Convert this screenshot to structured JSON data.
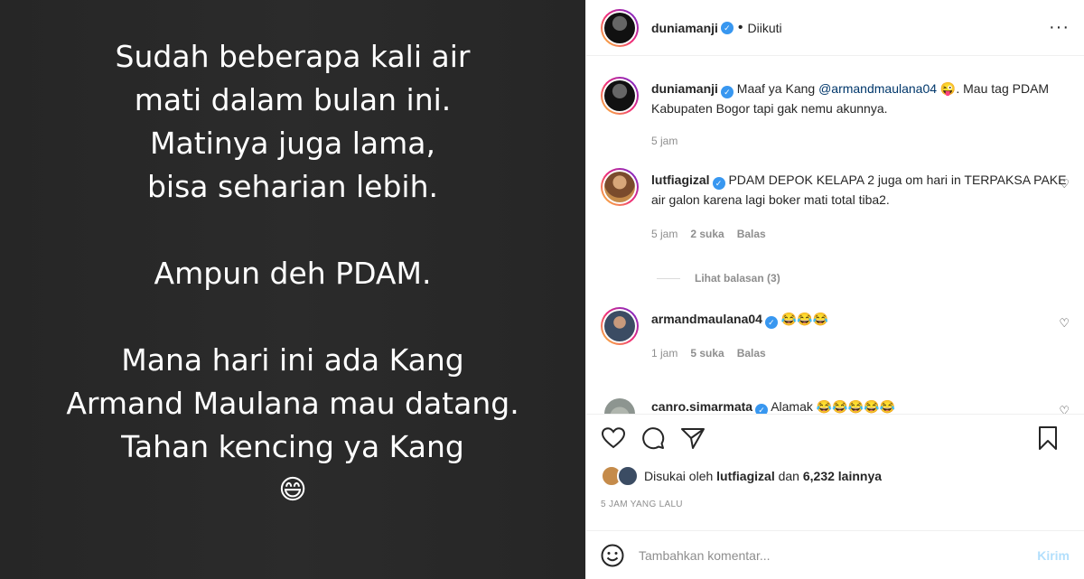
{
  "story": {
    "lines": [
      "Sudah beberapa kali air",
      "mati dalam bulan ini.",
      "Matinya juga lama,",
      "bisa seharian lebih.",
      "Ampun deh PDAM.",
      "Mana hari ini ada Kang",
      "Armand Maulana mau datang.",
      "Tahan kencing ya Kang",
      "😄"
    ]
  },
  "header": {
    "username": "duniamanji",
    "separator": "•",
    "follow_status": "Diikuti",
    "more": "···"
  },
  "comments": [
    {
      "username": "duniamanji",
      "text_before": " Maaf ya Kang ",
      "mention": "@armandmaulana04",
      "text_after": " 😜. Mau tag PDAM Kabupaten Bogor tapi gak nemu akunnya.",
      "time": "5 jam"
    },
    {
      "username": "lutfiagizal",
      "text": " PDAM DEPOK KELAPA 2 juga om hari in TERPAKSA PAKE air galon karena lagi boker mati total tiba2.",
      "time": "5 jam",
      "likes": "2 suka",
      "reply": "Balas"
    },
    {
      "username": "armandmaulana04",
      "text": " 😂😂😂",
      "time": "1 jam",
      "likes": "5 suka",
      "reply": "Balas"
    },
    {
      "username": "canro.simarmata",
      "text": " Alamak 😂😂😂😂😂"
    }
  ],
  "view_replies": "Lihat balasan (3)",
  "likes": {
    "prefix": "Disukai oleh ",
    "user": "lutfiagizal",
    "middle": " dan ",
    "count": "6,232 lainnya"
  },
  "timestamp": "5 JAM YANG LALU",
  "add_comment": {
    "placeholder": "Tambahkan komentar...",
    "send": "Kirim"
  }
}
